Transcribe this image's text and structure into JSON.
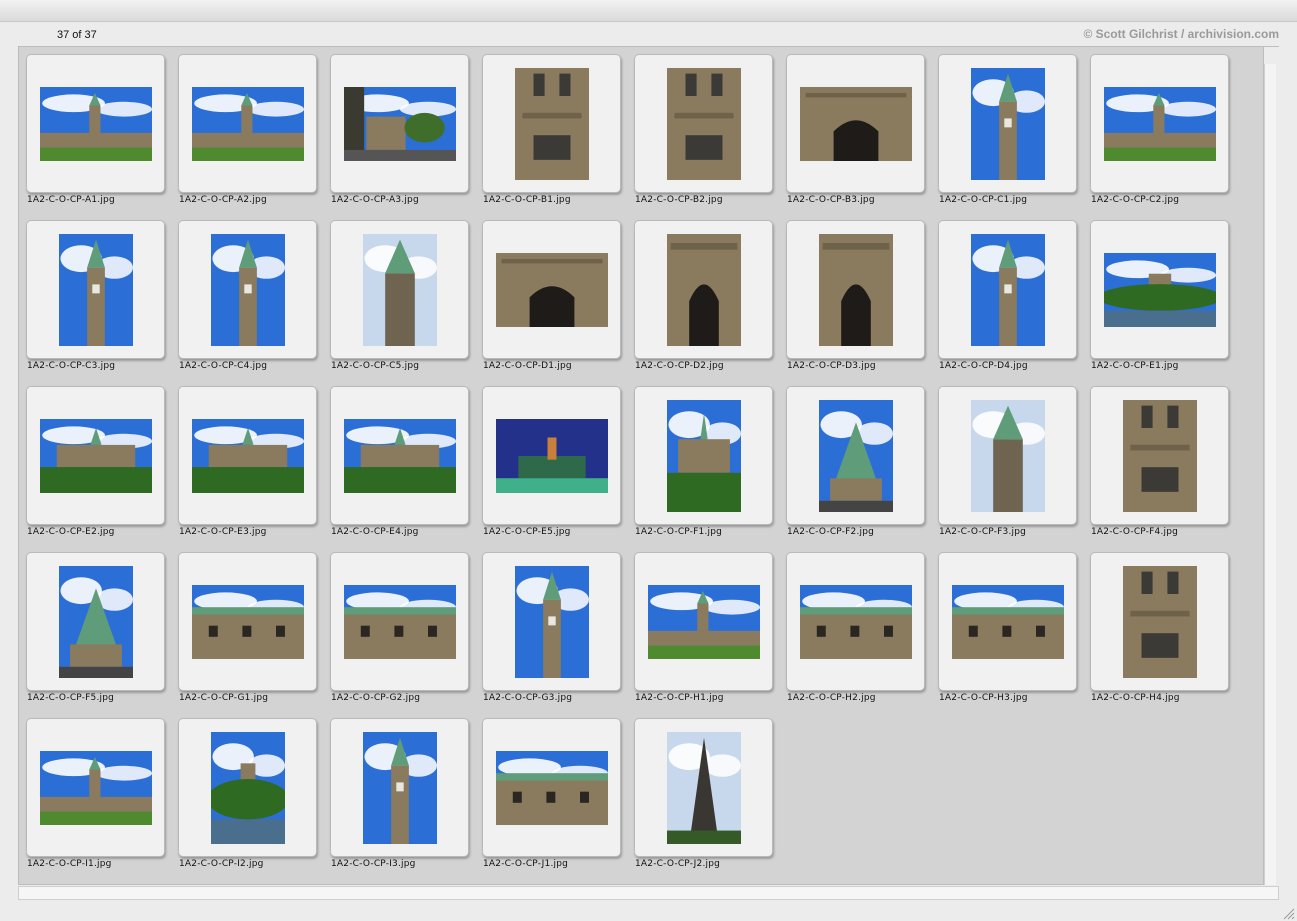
{
  "header": {
    "count": "37 of 37",
    "credit": "© Scott Gilchrist / archivision.com"
  },
  "colors": {
    "sky_blue": "#2b6fd6",
    "stone": "#8a7a5e",
    "copper_roof": "#5e9c7a",
    "grass": "#4f8a2f",
    "night_sky": "#23318a"
  },
  "images": [
    {
      "filename": "1A2-C-O-CP-A1.jpg",
      "orientation": "landscape",
      "scene": "sky-building"
    },
    {
      "filename": "1A2-C-O-CP-A2.jpg",
      "orientation": "landscape",
      "scene": "sky-building"
    },
    {
      "filename": "1A2-C-O-CP-A3.jpg",
      "orientation": "landscape",
      "scene": "street"
    },
    {
      "filename": "1A2-C-O-CP-B1.jpg",
      "orientation": "portrait",
      "scene": "stone-facade"
    },
    {
      "filename": "1A2-C-O-CP-B2.jpg",
      "orientation": "portrait",
      "scene": "stone-facade"
    },
    {
      "filename": "1A2-C-O-CP-B3.jpg",
      "orientation": "landscape",
      "scene": "stone-arch"
    },
    {
      "filename": "1A2-C-O-CP-C1.jpg",
      "orientation": "portrait",
      "scene": "tower-sky"
    },
    {
      "filename": "1A2-C-O-CP-C2.jpg",
      "orientation": "landscape",
      "scene": "sky-building"
    },
    {
      "filename": "1A2-C-O-CP-C3.jpg",
      "orientation": "portrait",
      "scene": "tower-sky"
    },
    {
      "filename": "1A2-C-O-CP-C4.jpg",
      "orientation": "portrait",
      "scene": "tower-sky"
    },
    {
      "filename": "1A2-C-O-CP-C5.jpg",
      "orientation": "portrait",
      "scene": "tower-pale"
    },
    {
      "filename": "1A2-C-O-CP-D1.jpg",
      "orientation": "landscape",
      "scene": "stone-arch"
    },
    {
      "filename": "1A2-C-O-CP-D2.jpg",
      "orientation": "portrait",
      "scene": "stone-arch"
    },
    {
      "filename": "1A2-C-O-CP-D3.jpg",
      "orientation": "portrait",
      "scene": "stone-arch"
    },
    {
      "filename": "1A2-C-O-CP-D4.jpg",
      "orientation": "portrait",
      "scene": "tower-sky"
    },
    {
      "filename": "1A2-C-O-CP-E1.jpg",
      "orientation": "landscape",
      "scene": "hill-water"
    },
    {
      "filename": "1A2-C-O-CP-E2.jpg",
      "orientation": "landscape",
      "scene": "hill-trees"
    },
    {
      "filename": "1A2-C-O-CP-E3.jpg",
      "orientation": "landscape",
      "scene": "hill-trees"
    },
    {
      "filename": "1A2-C-O-CP-E4.jpg",
      "orientation": "landscape",
      "scene": "hill-trees"
    },
    {
      "filename": "1A2-C-O-CP-E5.jpg",
      "orientation": "landscape",
      "scene": "night"
    },
    {
      "filename": "1A2-C-O-CP-F1.jpg",
      "orientation": "portrait",
      "scene": "hill-trees"
    },
    {
      "filename": "1A2-C-O-CP-F2.jpg",
      "orientation": "portrait",
      "scene": "library"
    },
    {
      "filename": "1A2-C-O-CP-F3.jpg",
      "orientation": "portrait",
      "scene": "tower-pale"
    },
    {
      "filename": "1A2-C-O-CP-F4.jpg",
      "orientation": "portrait",
      "scene": "stone-facade"
    },
    {
      "filename": "1A2-C-O-CP-F5.jpg",
      "orientation": "portrait",
      "scene": "library"
    },
    {
      "filename": "1A2-C-O-CP-G1.jpg",
      "orientation": "landscape",
      "scene": "facade-sky"
    },
    {
      "filename": "1A2-C-O-CP-G2.jpg",
      "orientation": "landscape",
      "scene": "facade-sky"
    },
    {
      "filename": "1A2-C-O-CP-G3.jpg",
      "orientation": "portrait",
      "scene": "tower-sky"
    },
    {
      "filename": "1A2-C-O-CP-H1.jpg",
      "orientation": "landscape",
      "scene": "sky-building"
    },
    {
      "filename": "1A2-C-O-CP-H2.jpg",
      "orientation": "landscape",
      "scene": "facade-sky"
    },
    {
      "filename": "1A2-C-O-CP-H3.jpg",
      "orientation": "landscape",
      "scene": "facade-sky"
    },
    {
      "filename": "1A2-C-O-CP-H4.jpg",
      "orientation": "portrait",
      "scene": "stone-facade"
    },
    {
      "filename": "1A2-C-O-CP-I1.jpg",
      "orientation": "landscape",
      "scene": "sky-building"
    },
    {
      "filename": "1A2-C-O-CP-I2.jpg",
      "orientation": "portrait",
      "scene": "hill-water"
    },
    {
      "filename": "1A2-C-O-CP-I3.jpg",
      "orientation": "portrait",
      "scene": "tower-sky"
    },
    {
      "filename": "1A2-C-O-CP-J1.jpg",
      "orientation": "landscape",
      "scene": "facade-sky"
    },
    {
      "filename": "1A2-C-O-CP-J2.jpg",
      "orientation": "portrait",
      "scene": "spire-pale"
    }
  ]
}
